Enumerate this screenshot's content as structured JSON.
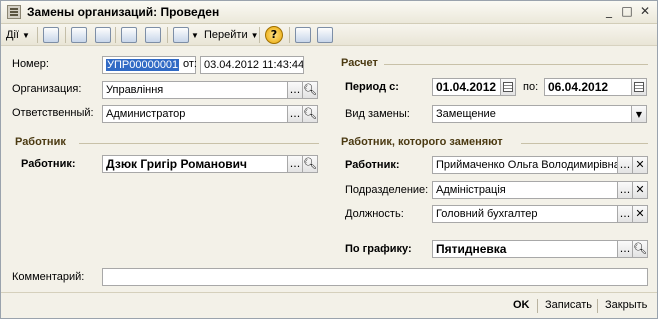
{
  "window": {
    "title": "Замены организаций: Проведен",
    "minimize": "_",
    "maximize": "□",
    "close": "✕"
  },
  "toolbar": {
    "actions_label": "Дії",
    "goto_label": "Перейти",
    "help": "?"
  },
  "header": {
    "number_label": "Номер:",
    "number_value": "УПР00000001",
    "from_label": "от:",
    "date_value": "03.04.2012 11:43:44",
    "org_label": "Организация:",
    "org_value": "Управління",
    "resp_label": "Ответственный:",
    "resp_value": "Администратор"
  },
  "worker_section": {
    "title": "Работник",
    "worker_label": "Работник:",
    "worker_value": "Дзюк Григір Романович"
  },
  "calc_section": {
    "title": "Расчет",
    "period_label": "Период с:",
    "period_from": "01.04.2012",
    "to_label": "по:",
    "period_to": "06.04.2012",
    "kind_label": "Вид замены:",
    "kind_value": "Замещение"
  },
  "replaced_section": {
    "title": "Работник, которого заменяют",
    "worker_label": "Работник:",
    "worker_value": "Приймаченко Ольга Володимирівна",
    "dept_label": "Подразделение:",
    "dept_value": "Адміністрація",
    "position_label": "Должность:",
    "position_value": "Головний бухгалтер",
    "schedule_label": "По графику:",
    "schedule_value": "Пятидневка"
  },
  "comment": {
    "label": "Комментарий:",
    "value": ""
  },
  "footer": {
    "ok": "OK",
    "save": "Записать",
    "close": "Закрыть"
  },
  "icons": {
    "ellipsis": "...",
    "clear": "✕",
    "dropdown": "▼"
  }
}
